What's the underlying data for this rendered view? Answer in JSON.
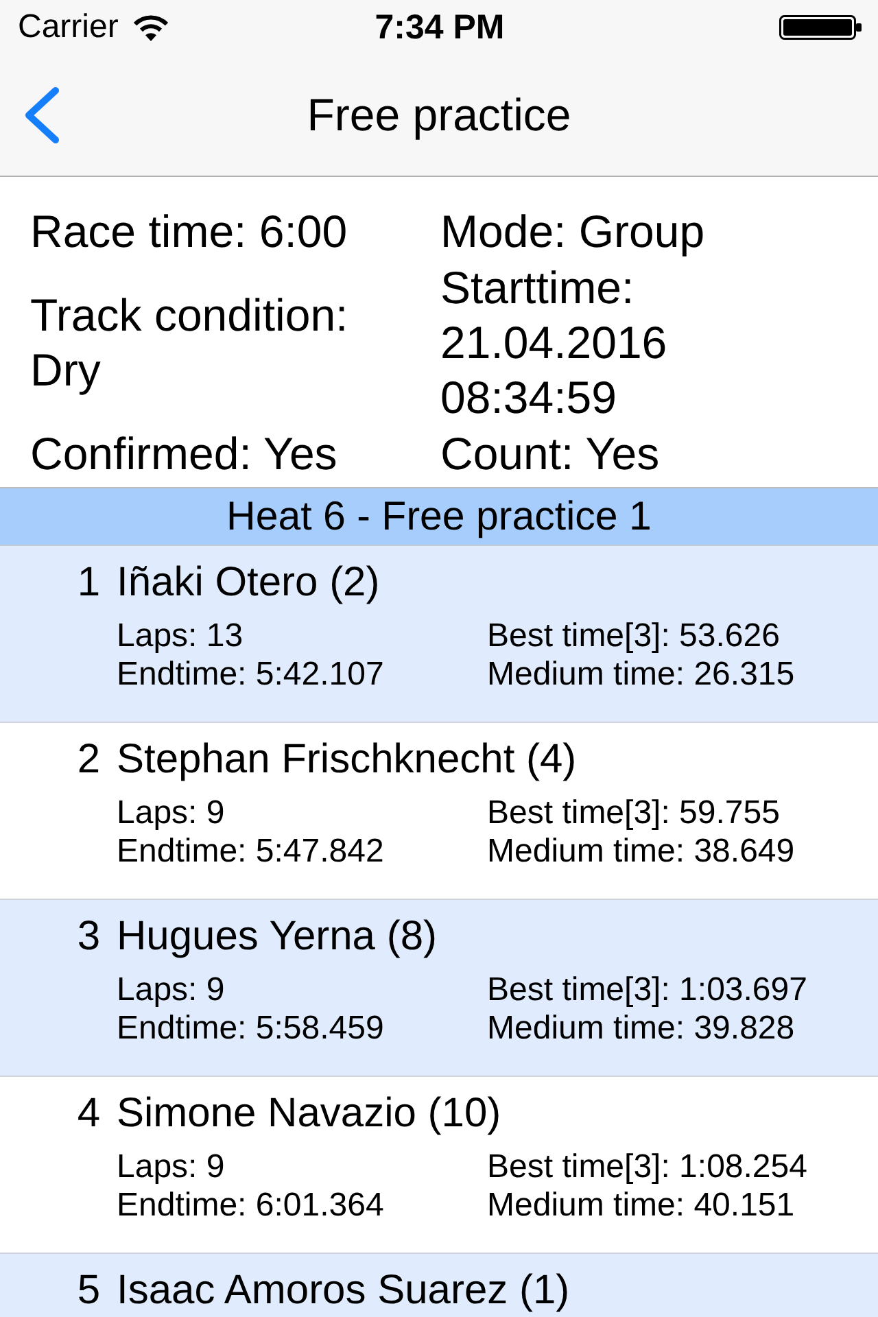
{
  "status_bar": {
    "carrier": "Carrier",
    "time": "7:34 PM"
  },
  "nav_bar": {
    "title": "Free practice"
  },
  "race_info": {
    "left_column": [
      "Race time: 6:00",
      "Track condition: Dry",
      "Confirmed: Yes"
    ],
    "right_column": [
      "Mode: Group",
      "Starttime: 21.04.2016 08:34:59",
      "Count: Yes"
    ]
  },
  "heat": {
    "title": "Heat 6 - Free practice 1",
    "results": [
      {
        "place": "1",
        "driver": "Iñaki Otero (2)",
        "laps": "Laps: 13",
        "best_time": "Best time[3]: 53.626",
        "endtime": "Endtime: 5:42.107",
        "medium_time": "Medium time: 26.315"
      },
      {
        "place": "2",
        "driver": "Stephan Frischknecht (4)",
        "laps": "Laps: 9",
        "best_time": "Best time[3]: 59.755",
        "endtime": "Endtime: 5:47.842",
        "medium_time": "Medium time: 38.649"
      },
      {
        "place": "3",
        "driver": "Hugues Yerna (8)",
        "laps": "Laps: 9",
        "best_time": "Best time[3]: 1:03.697",
        "endtime": "Endtime: 5:58.459",
        "medium_time": "Medium time: 39.828"
      },
      {
        "place": "4",
        "driver": "Simone Navazio (10)",
        "laps": "Laps: 9",
        "best_time": "Best time[3]: 1:08.254",
        "endtime": "Endtime: 6:01.364",
        "medium_time": "Medium time: 40.151"
      },
      {
        "place": "5",
        "driver": "Isaac Amoros Suarez (1)"
      }
    ]
  }
}
